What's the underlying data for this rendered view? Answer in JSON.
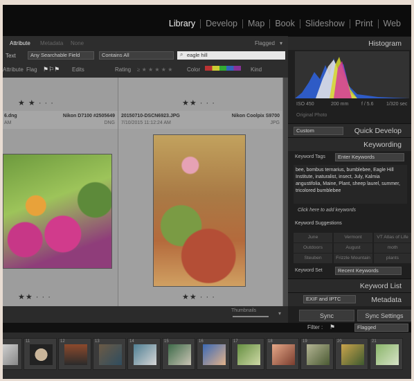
{
  "modules": [
    "Library",
    "Develop",
    "Map",
    "Book",
    "Slideshow",
    "Print",
    "Web"
  ],
  "active_module": "Library",
  "filter_bar": {
    "tabs": [
      "Attribute",
      "Metadata",
      "None"
    ],
    "flagged_label": "Flagged",
    "text_label": "Text",
    "field_select": "Any Searchable Field",
    "rule_select": "Contains All",
    "search_value": "eagle hill",
    "attribute_label": "Attribute",
    "flag_label": "Flag",
    "edits_label": "Edits",
    "rating_label": "Rating",
    "color_label": "Color",
    "kind_label": "Kind"
  },
  "grid": {
    "left_cell": {
      "filename": "6.dng",
      "camera": "Nikon D7100 #2505649",
      "ext": "DNG",
      "ampm": "AM",
      "rating_stars": 2
    },
    "right_cell": {
      "filename": "20150710-DSCN6923.JPG",
      "camera": "Nikon Coolpix S9700",
      "date": "7/10/2015 11:12:24 AM",
      "ext": "JPG",
      "rating_stars": 2
    },
    "thumbnails_label": "Thumbnails"
  },
  "histogram": {
    "title": "Histogram",
    "iso": "ISO 450",
    "focal": "200 mm",
    "aperture": "f / 5.6",
    "shutter": "1/320 sec",
    "original_photo": "Original Photo"
  },
  "quick_develop": {
    "title": "Quick Develop",
    "preset": "Custom"
  },
  "keywording": {
    "title": "Keywording",
    "keyword_tags_label": "Keyword Tags",
    "keyword_tags_select": "Enter Keywords",
    "keywords_text": "bee, bombus ternarius, bumblebee, Eagle Hill Institute, inaturalist, insect, July, Kalmia angustifolia, Maine, Plant, sheep laurel, summer, tricolored bumblebee",
    "add_hint": "Click here to add keywords",
    "suggestions_label": "Keyword Suggestions",
    "suggestions": [
      "June",
      "Vermont",
      "VT Atlas of Life",
      "Outdoors",
      "August",
      "moth",
      "Steuben",
      "Frizzle Mountain",
      "plants"
    ],
    "keyword_set_label": "Keyword Set",
    "keyword_set_select": "Recent Keywords"
  },
  "keyword_list": {
    "title": "Keyword List"
  },
  "metadata": {
    "title": "Metadata",
    "preset": "EXIF and IPTC"
  },
  "sync": {
    "sync_label": "Sync",
    "sync_settings_label": "Sync Settings"
  },
  "filmstrip_filter": {
    "label": "Filter :",
    "value": "Flagged"
  },
  "filmstrip": {
    "numbers": [
      "",
      "11",
      "12",
      "13",
      "14",
      "15",
      "16",
      "17",
      "18",
      "19",
      "20",
      "21"
    ]
  },
  "colors": {
    "accent": "#f0f0f0",
    "panel": "#1f1f1f",
    "grid": "#9d9d9d"
  }
}
